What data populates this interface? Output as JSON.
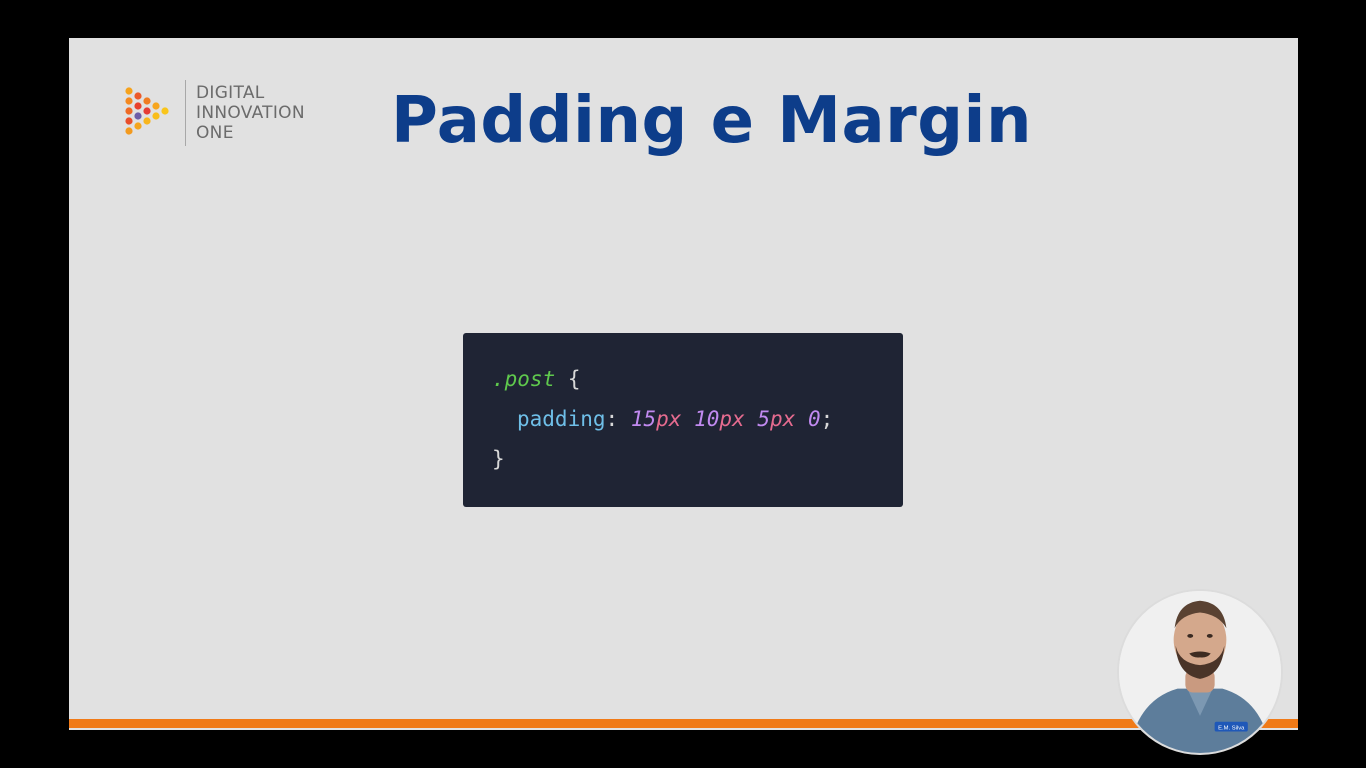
{
  "brand": {
    "line1": "DIGITAL",
    "line2": "INNOVATION",
    "line3": "ONE"
  },
  "slide": {
    "title": "Padding e Margin"
  },
  "code": {
    "selector": ".post",
    "open_brace": " {",
    "property": "padding",
    "colon": ":",
    "values": [
      {
        "num": "15",
        "unit": "px"
      },
      {
        "num": "10",
        "unit": "px"
      },
      {
        "num": "5",
        "unit": "px"
      },
      {
        "num": "0",
        "unit": ""
      }
    ],
    "semicolon": ";",
    "close_brace": "}"
  },
  "presenter": {
    "badge": "E.M. Silva"
  },
  "colors": {
    "title": "#0d3d8a",
    "accent_bar": "#f07a17",
    "slide_bg": "#e1e1e1",
    "code_bg": "#1f2434"
  },
  "icons": {
    "logo": "dio-logo-icon"
  }
}
